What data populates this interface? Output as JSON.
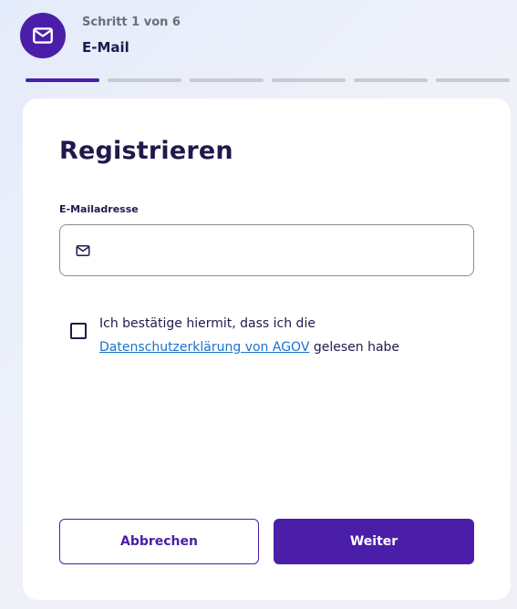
{
  "header": {
    "icon": "envelope-icon",
    "step_counter": "Schritt 1 von 6",
    "step_title": "E-Mail",
    "total_steps": 6,
    "current_step": 1
  },
  "form": {
    "title": "Registrieren",
    "email": {
      "label": "E-Mailadresse",
      "value": "",
      "placeholder": "",
      "icon": "envelope-icon"
    },
    "consent": {
      "checked": false,
      "text_before": "Ich bestätige hiermit, dass ich die ",
      "link_text": "Datenschutzerklärung von AGOV",
      "text_after": " gelesen habe"
    },
    "buttons": {
      "cancel_label": "Abbrechen",
      "next_label": "Weiter"
    }
  },
  "colors": {
    "accent": "#4a1ea8",
    "link": "#1a73c7",
    "text": "#1f1a4b",
    "progress_inactive": "#c9cad1"
  }
}
